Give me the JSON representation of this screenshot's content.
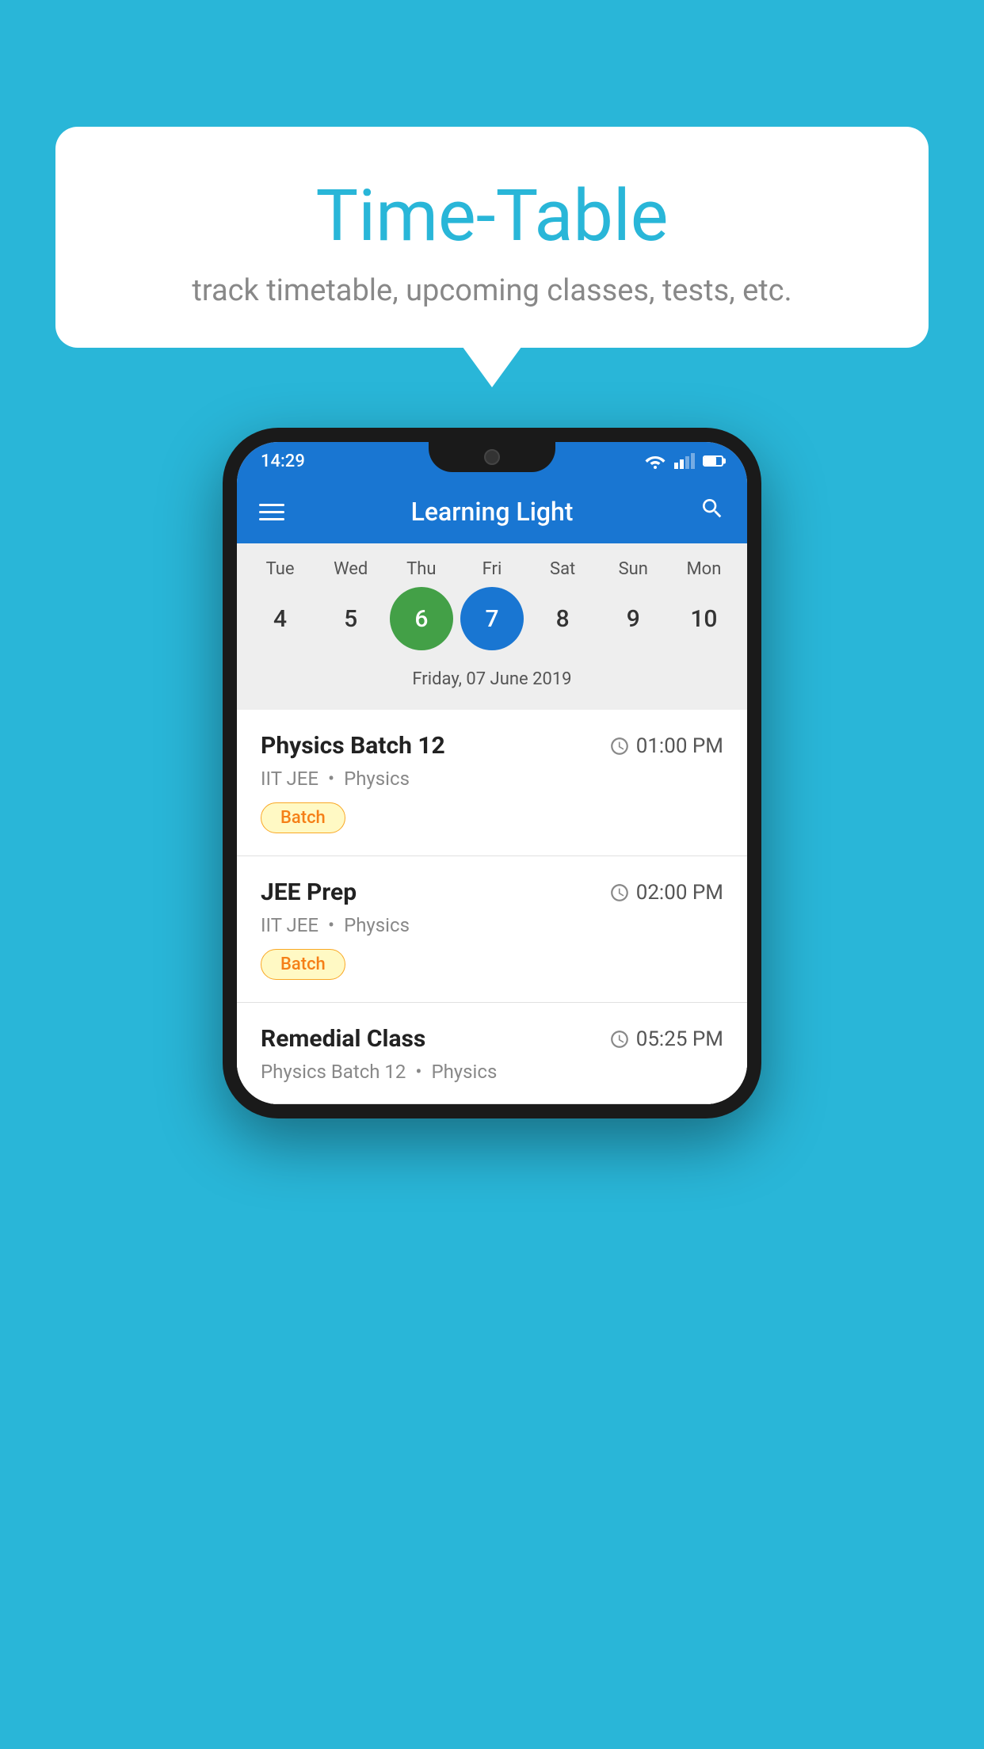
{
  "background": {
    "color": "#29B6D8"
  },
  "speech_bubble": {
    "title": "Time-Table",
    "subtitle": "track timetable, upcoming classes, tests, etc."
  },
  "phone": {
    "status_bar": {
      "time": "14:29"
    },
    "app_bar": {
      "title": "Learning Light"
    },
    "calendar": {
      "days": [
        "Tue",
        "Wed",
        "Thu",
        "Fri",
        "Sat",
        "Sun",
        "Mon"
      ],
      "dates": [
        "4",
        "5",
        "6",
        "7",
        "8",
        "9",
        "10"
      ],
      "today_index": 2,
      "selected_index": 3,
      "selected_date_label": "Friday, 07 June 2019"
    },
    "events": [
      {
        "title": "Physics Batch 12",
        "time": "01:00 PM",
        "subtitle_course": "IIT JEE",
        "subtitle_subject": "Physics",
        "badge": "Batch"
      },
      {
        "title": "JEE Prep",
        "time": "02:00 PM",
        "subtitle_course": "IIT JEE",
        "subtitle_subject": "Physics",
        "badge": "Batch"
      },
      {
        "title": "Remedial Class",
        "time": "05:25 PM",
        "subtitle_course": "Physics Batch 12",
        "subtitle_subject": "Physics",
        "badge": ""
      }
    ]
  }
}
